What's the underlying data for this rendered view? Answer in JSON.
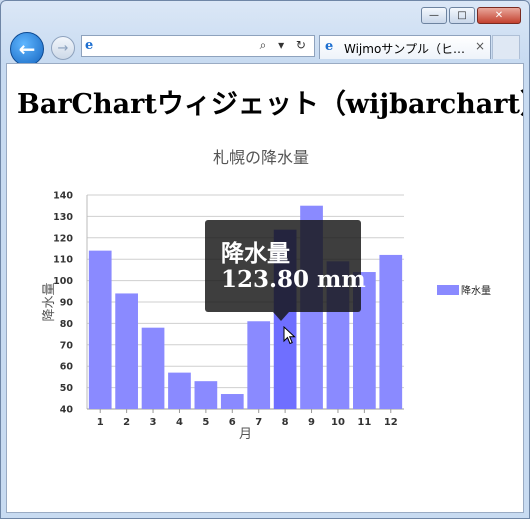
{
  "browser": {
    "tab_title": "Wijmoサンプル（ヒ…",
    "tab_close": "×",
    "forward_glyph": "→",
    "back_glyph": "←",
    "ie_glyph": "e",
    "address_tools": "⌕ ▾ ↻",
    "window_buttons": {
      "minimize": "—",
      "maximize": "□",
      "close": "✕"
    }
  },
  "page": {
    "heading": "BarChartウィジェット（wijbarchart）"
  },
  "chart_data": {
    "type": "bar",
    "title": "札幌の降水量",
    "xlabel": "月",
    "ylabel": "降水量",
    "ylim": [
      40,
      140
    ],
    "yticks": [
      40,
      50,
      60,
      70,
      80,
      90,
      100,
      110,
      120,
      130,
      140
    ],
    "categories": [
      "1",
      "2",
      "3",
      "4",
      "5",
      "6",
      "7",
      "8",
      "9",
      "10",
      "11",
      "12"
    ],
    "series": [
      {
        "name": "降水量",
        "color": "#8a8aff",
        "highlight_color": "#6f6fff",
        "values": [
          114,
          94,
          78,
          57,
          53,
          47,
          81,
          123.8,
          135,
          109,
          104,
          112
        ]
      }
    ],
    "legend": "right",
    "grid": true,
    "tooltip": {
      "series": "降水量",
      "value_text": "123.80 mm",
      "category_index": 7
    }
  }
}
